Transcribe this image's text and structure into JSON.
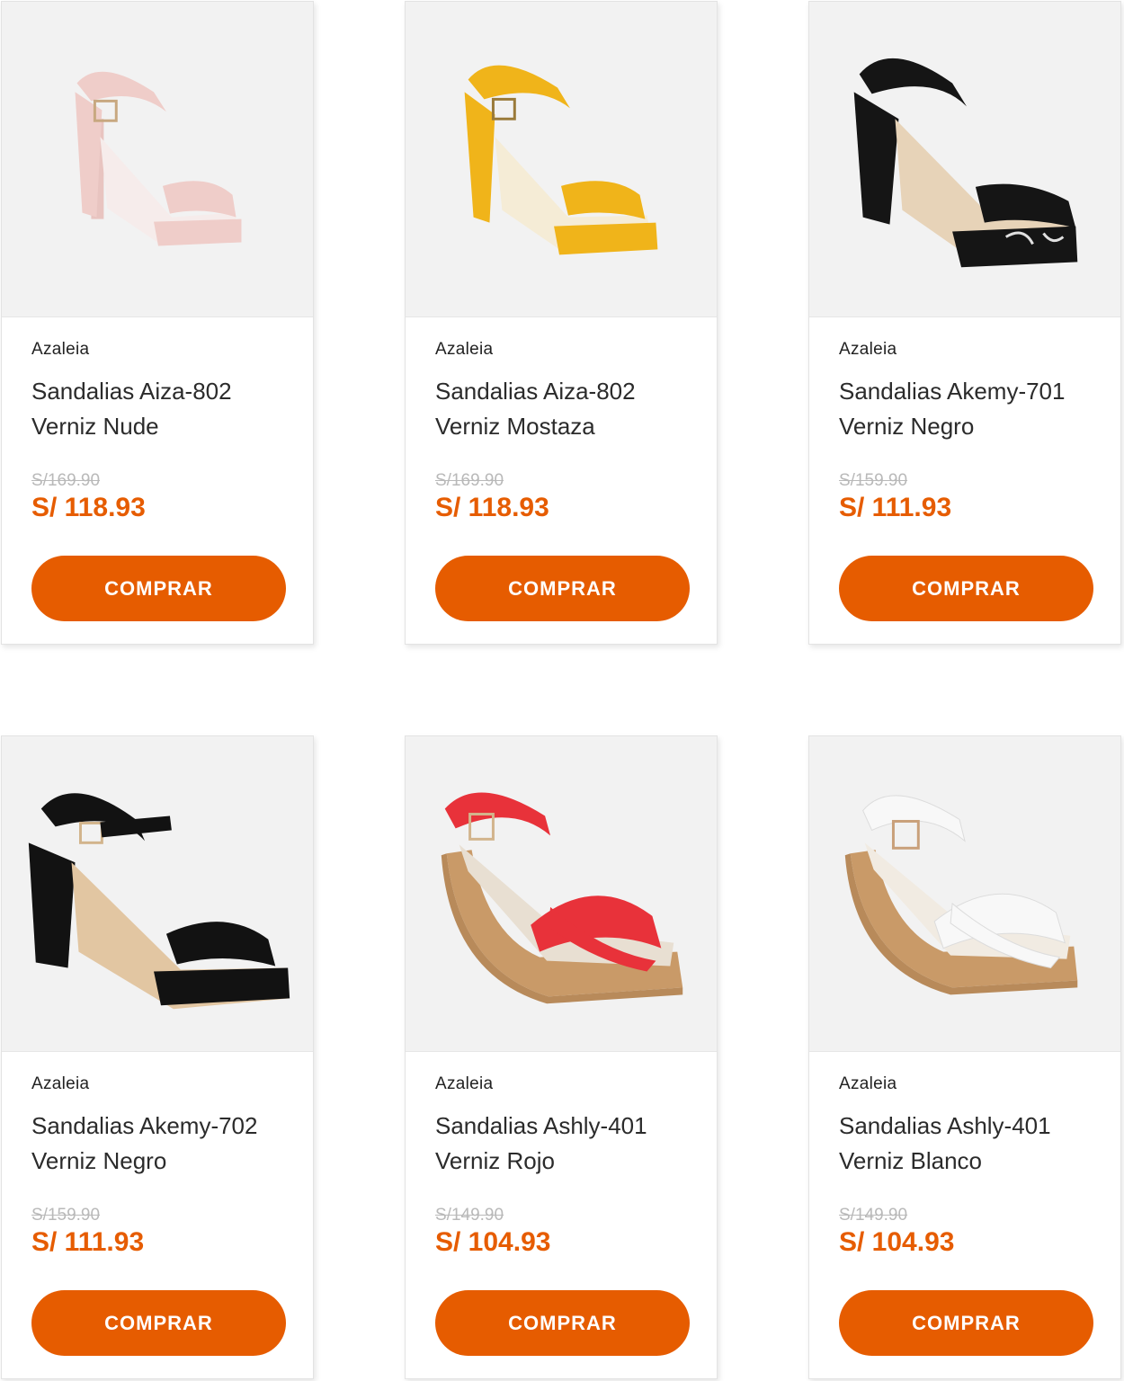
{
  "products": [
    {
      "brand": "Azaleia",
      "name": "Sandalias Aiza-802 Verniz Nude",
      "old_price": "S/169.90",
      "price": "S/ 118.93",
      "button": "COMPRAR",
      "image": "nude-block-heel-sandal",
      "color": "#efcdc9"
    },
    {
      "brand": "Azaleia",
      "name": "Sandalias Aiza-802 Verniz Mostaza",
      "old_price": "S/169.90",
      "price": "S/ 118.93",
      "button": "COMPRAR",
      "image": "mustard-block-heel-sandal",
      "color": "#f0b41a"
    },
    {
      "brand": "Azaleia",
      "name": "Sandalias Akemy-701 Verniz Negro",
      "old_price": "S/159.90",
      "price": "S/ 111.93",
      "button": "COMPRAR",
      "image": "black-print-block-heel-sandal",
      "color": "#151515"
    },
    {
      "brand": "Azaleia",
      "name": "Sandalias Akemy-702 Verniz Negro",
      "old_price": "S/159.90",
      "price": "S/ 111.93",
      "button": "COMPRAR",
      "image": "black-block-heel-sandal",
      "color": "#121212"
    },
    {
      "brand": "Azaleia",
      "name": "Sandalias Ashly-401 Verniz Rojo",
      "old_price": "S/149.90",
      "price": "S/ 104.93",
      "button": "COMPRAR",
      "image": "red-wedge-sandal",
      "color": "#e8323a"
    },
    {
      "brand": "Azaleia",
      "name": "Sandalias Ashly-401 Verniz Blanco",
      "old_price": "S/149.90",
      "price": "S/ 104.93",
      "button": "COMPRAR",
      "image": "white-wedge-sandal",
      "color": "#f8f8f8"
    }
  ],
  "colors": {
    "accent": "#e65c00",
    "image_bg": "#f2f2f2",
    "old_price": "#b9b9b9",
    "cork": "#c99a68",
    "tan_insole": "#d9b48f"
  }
}
